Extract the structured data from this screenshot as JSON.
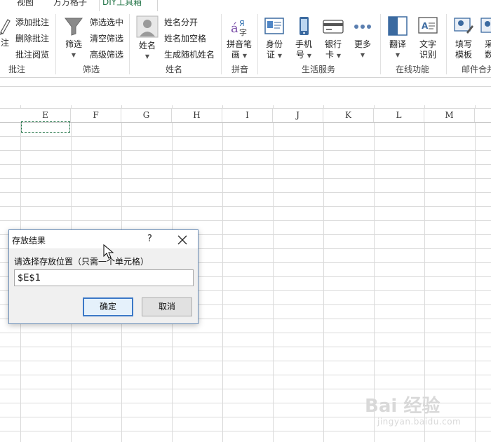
{
  "tabs": [
    {
      "label": "视图",
      "active": false
    },
    {
      "label": "方方格子",
      "active": false
    },
    {
      "label": "DIY工具箱",
      "active": true
    }
  ],
  "ribbon": {
    "comment": {
      "group_label": "批注",
      "partial_left_label": "注",
      "items": [
        "添加批注",
        "删除批注",
        "批注阅览"
      ]
    },
    "filter": {
      "group_label": "筛选",
      "big_button": "筛选",
      "items": [
        "筛选选中",
        "清空筛选",
        "高级筛选"
      ]
    },
    "name": {
      "group_label": "姓名",
      "big_button": "姓名",
      "items": [
        "姓名分开",
        "姓名加空格",
        "生成随机姓名"
      ]
    },
    "pinyin": {
      "group_label": "拼音",
      "big_button_line1": "拼音笔",
      "big_button_line2": "画"
    },
    "life": {
      "group_label": "生活服务",
      "buttons": [
        {
          "line1": "身份",
          "line2": "证"
        },
        {
          "line1": "手机",
          "line2": "号"
        },
        {
          "line1": "银行",
          "line2": "卡"
        },
        {
          "line1": "更多",
          "line2": ""
        }
      ]
    },
    "online": {
      "group_label": "在线功能",
      "buttons": [
        {
          "line1": "翻译",
          "line2": ""
        },
        {
          "line1": "文字",
          "line2": "识别"
        }
      ]
    },
    "mail": {
      "group_label": "邮件合并",
      "buttons": [
        {
          "line1": "填写",
          "line2": "模板"
        },
        {
          "line1": "采",
          "line2": "数"
        }
      ]
    }
  },
  "columns": [
    "E",
    "F",
    "G",
    "H",
    "I",
    "J",
    "K",
    "L",
    "M"
  ],
  "dialog": {
    "title": "存放结果",
    "help": "?",
    "prompt": "请选择存放位置（只需一个单元格）",
    "value": "$E$1",
    "ok_label": "确定",
    "cancel_label": "取消"
  },
  "watermark": {
    "main": "Bai 经验",
    "sub": "jingyan.baidu.com"
  },
  "colors": {
    "accent": "#217346",
    "dialog_border": "#6c8fb8",
    "primary_button": "#3b78c7"
  }
}
